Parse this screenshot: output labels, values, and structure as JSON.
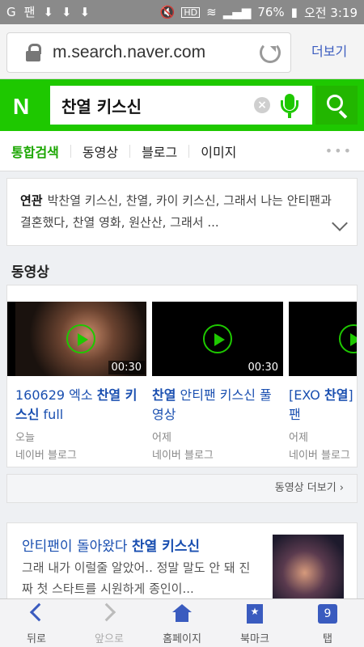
{
  "status_bar": {
    "left_icons": [
      "G",
      "팬",
      "⬇",
      "⬇",
      "⬇"
    ],
    "battery": "76%",
    "time": "오전 3:19"
  },
  "browser": {
    "url": "m.search.naver.com",
    "more_label": "더보기"
  },
  "search": {
    "logo": "N",
    "query": "찬열 키스신",
    "clear": "×"
  },
  "tabs": [
    {
      "label": "통합검색"
    },
    {
      "label": "동영상"
    },
    {
      "label": "블로그"
    },
    {
      "label": "이미지"
    }
  ],
  "tabs_more": "•••",
  "related": {
    "heading": "연관",
    "text": "박찬열 키스신, 찬열, 카이 키스신, 그래서 나는 안티팬과 결혼했다, 찬열 영화, 원산산, 그래서 ..."
  },
  "video_section": {
    "title": "동영상",
    "items": [
      {
        "title_plain": "160629 엑소 ",
        "title_hl": "찬열 키스신",
        "title_tail": " full",
        "duration": "00:30",
        "date": "오늘",
        "source": "네이버 블로그"
      },
      {
        "title_plain": "",
        "title_hl": "찬열",
        "title_tail": " 안티팬 키스신 풀영상",
        "duration": "00:30",
        "date": "어제",
        "source": "네이버 블로그"
      },
      {
        "title_plain": "[EXO ",
        "title_hl": "찬열",
        "title_tail": "] 나는 안티팬",
        "duration": "",
        "date": "어제",
        "source": "네이버 블로그"
      }
    ],
    "more_label": "동영상 더보기 ›"
  },
  "blog": {
    "title_plain": "안티팬이 돌아왔다 ",
    "title_hl": "찬열 키스신",
    "desc": "그래 내가 이럴줄 알았어.. 정말 말도 안 돼 진짜 첫 스타트를 시원하게 종인이..."
  },
  "bottom_nav": [
    {
      "label": "뒤로"
    },
    {
      "label": "앞으로"
    },
    {
      "label": "홈페이지"
    },
    {
      "label": "북마크"
    },
    {
      "label": "탭",
      "count": "9"
    }
  ],
  "colors": {
    "naver_green": "#1ec800",
    "link_blue": "#1a4fb0",
    "nav_blue": "#3a5bbf"
  }
}
